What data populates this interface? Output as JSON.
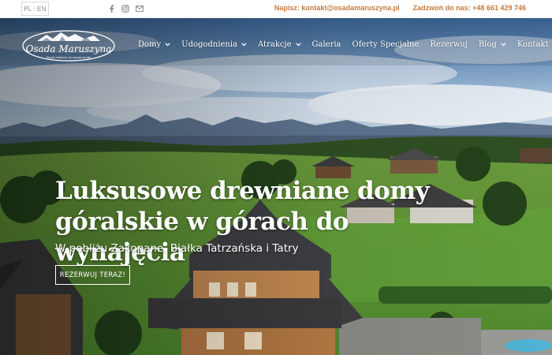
{
  "topbar": {
    "language": {
      "current": "PL",
      "other": "EN"
    },
    "socials": [
      "facebook-icon",
      "instagram-icon",
      "mail-icon"
    ],
    "email_text": "Napisz: kontakt@osadamaruszyna.pl",
    "phone_text": "Zadzwoń do nas: +48 661 429 746",
    "accent_color": "#c87a3b"
  },
  "logo": {
    "name": "Osada Maruszyna",
    "tagline": "Twoje miejsce na wypoczynek"
  },
  "nav": {
    "items": [
      {
        "label": "Domy",
        "dropdown": true
      },
      {
        "label": "Udogodnienia",
        "dropdown": true
      },
      {
        "label": "Atrakcje",
        "dropdown": true
      },
      {
        "label": "Galeria",
        "dropdown": false
      },
      {
        "label": "Oferty Specjalne",
        "dropdown": false
      },
      {
        "label": "Rezerwuj",
        "dropdown": false
      },
      {
        "label": "Blog",
        "dropdown": true
      },
      {
        "label": "Kontakt",
        "dropdown": true
      }
    ]
  },
  "hero": {
    "headline_line1": "Luksusowe drewniane domy",
    "headline_line2": "góralskie w górach do wynajęcia",
    "subheadline": "W pobliżu Zakopane, Białka Tatrzańska i Tatry",
    "cta_label": "REZERWUJ TERAZ!"
  }
}
